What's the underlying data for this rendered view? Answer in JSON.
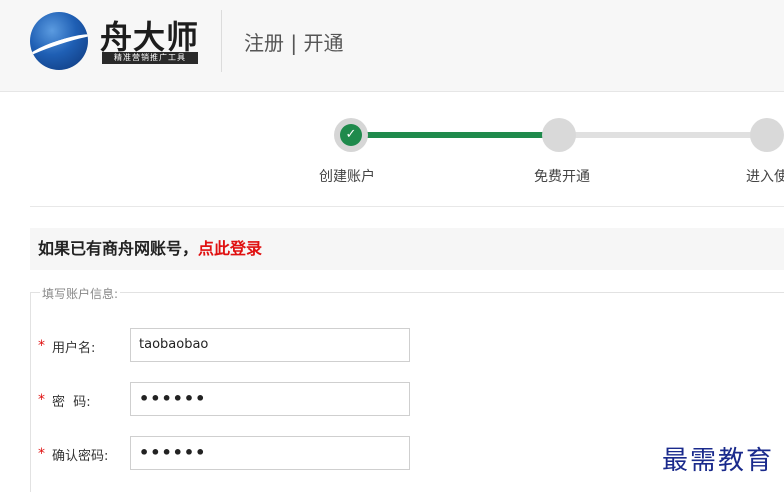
{
  "header": {
    "brand_name": "舟大师",
    "brand_tagline": "精准营销推广工具",
    "page_title": "注册 | 开通"
  },
  "steps": [
    {
      "label": "创建账户",
      "status": "done",
      "check": "✓"
    },
    {
      "label": "免费开通",
      "status": "todo"
    },
    {
      "label": "进入使",
      "status": "todo"
    }
  ],
  "login_prompt": {
    "text": "如果已有商舟网账号，",
    "link": "点此登录"
  },
  "form": {
    "legend": "填写账户信息:",
    "required_mark": "*",
    "fields": [
      {
        "label": "用户名:",
        "value": "taobaobao"
      },
      {
        "label": "密  码:",
        "value": "••••••"
      },
      {
        "label": "确认密码:",
        "value": "••••••"
      }
    ]
  },
  "watermark": "最需教育",
  "colors": {
    "accent_green": "#1f8a4c",
    "link_red": "#e01010",
    "watermark_blue": "#1a2a8c"
  },
  "icons": [
    "globe-logo-icon",
    "checkmark-icon"
  ]
}
